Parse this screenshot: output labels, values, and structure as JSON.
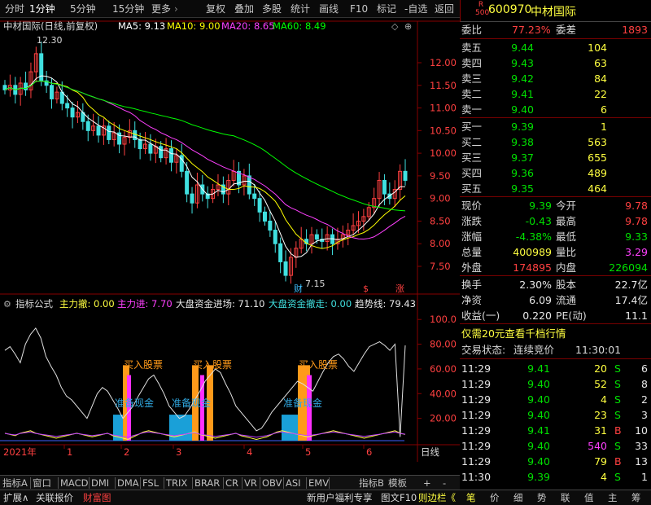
{
  "toolbar": {
    "periods": [
      "分时",
      "1分钟",
      "5分钟",
      "15分钟",
      "更多"
    ],
    "more_arrow": "›",
    "actions": [
      "复权",
      "叠加",
      "多股",
      "统计",
      "画线",
      "F10",
      "标记",
      "-自选",
      "返回"
    ]
  },
  "stock": {
    "code": "600970",
    "name": "中材国际",
    "badge_top": "R",
    "badge_bottom": "500"
  },
  "kline": {
    "title": "中材国际(日线,前复权)",
    "ma5_label": "MA5: 9.13",
    "ma10_label": "MA10: 9.00",
    "ma20_label": "MA20: 8.65",
    "ma60_label": "MA60: 8.49",
    "high_label": "12.30",
    "low_label": "7.15",
    "y_ticks": [
      "12.00",
      "11.50",
      "11.00",
      "10.50",
      "10.00",
      "9.50",
      "9.00",
      "8.50",
      "8.00",
      "7.50"
    ],
    "y_values": [
      12.0,
      11.5,
      11.0,
      10.5,
      10.0,
      9.5,
      9.0,
      8.5,
      8.0,
      7.5
    ],
    "ylim": [
      7.05,
      12.45
    ],
    "markers": [
      {
        "text": "财",
        "color": "#40c0ff"
      },
      {
        "text": "$",
        "color": "#ff4040"
      },
      {
        "text": "涨",
        "color": "#ff4040"
      }
    ],
    "colors": {
      "ma5": "#ffffff",
      "ma10": "#ffff00",
      "ma20": "#ff40ff",
      "ma60": "#00ff00",
      "up": "#ff4040",
      "down": "#40e0e0"
    }
  },
  "indicator": {
    "name": "指标公式",
    "labels": [
      {
        "text": "主力撤: 0.00",
        "color": "#ffff40"
      },
      {
        "text": "主力进: 7.70",
        "color": "#ff40ff"
      },
      {
        "text": "大盘资金进场: 71.10",
        "color": "#e8e8e8"
      },
      {
        "text": "大盘资金撤走: 0.00",
        "color": "#40e0e0"
      },
      {
        "text": "趋势线: 79.43",
        "color": "#e8e8e8"
      }
    ],
    "y_ticks": [
      "100.0",
      "80.00",
      "60.00",
      "40.00",
      "20.00"
    ],
    "y_values": [
      100,
      80,
      60,
      40,
      20
    ],
    "ylim": [
      0,
      112
    ],
    "buy_label": "买入股票",
    "prepare_label_1": "准备现金",
    "prepare_label_2": "准备现金",
    "prepare_label_3": "准备现金"
  },
  "x_axis": {
    "year_label": "2021年",
    "month_labels": [
      "1",
      "2",
      "3",
      "4",
      "5",
      "6"
    ],
    "period_label": "日线"
  },
  "quote": {
    "wei_bi_label": "委比",
    "wei_bi_value": "77.23%",
    "wei_cha_label": "委差",
    "wei_cha_value": "1893",
    "sells": [
      {
        "label": "卖五",
        "price": "9.44",
        "vol": "104"
      },
      {
        "label": "卖四",
        "price": "9.43",
        "vol": "63"
      },
      {
        "label": "卖三",
        "price": "9.42",
        "vol": "84"
      },
      {
        "label": "卖二",
        "price": "9.41",
        "vol": "22"
      },
      {
        "label": "卖一",
        "price": "9.40",
        "vol": "6"
      }
    ],
    "buys": [
      {
        "label": "买一",
        "price": "9.39",
        "vol": "1"
      },
      {
        "label": "买二",
        "price": "9.38",
        "vol": "563"
      },
      {
        "label": "买三",
        "price": "9.37",
        "vol": "655"
      },
      {
        "label": "买四",
        "price": "9.36",
        "vol": "489"
      },
      {
        "label": "买五",
        "price": "9.35",
        "vol": "464"
      }
    ],
    "stats": [
      {
        "l1": "现价",
        "v1": "9.39",
        "c1": "green",
        "l2": "今开",
        "v2": "9.78",
        "c2": "red"
      },
      {
        "l1": "涨跌",
        "v1": "-0.43",
        "c1": "green",
        "l2": "最高",
        "v2": "9.78",
        "c2": "red"
      },
      {
        "l1": "涨幅",
        "v1": "-4.38%",
        "c1": "green",
        "l2": "最低",
        "v2": "9.33",
        "c2": "green"
      },
      {
        "l1": "总量",
        "v1": "400989",
        "c1": "yellow",
        "l2": "量比",
        "v2": "3.29",
        "c2": "magenta"
      },
      {
        "l1": "外盘",
        "v1": "174895",
        "c1": "red",
        "l2": "内盘",
        "v2": "226094",
        "c2": "green"
      }
    ],
    "fin": [
      {
        "l1": "换手",
        "v1": "2.30%",
        "l2": "股本",
        "v2": "22.7亿"
      },
      {
        "l1": "净资",
        "v1": "6.09",
        "l2": "流通",
        "v2": "17.4亿"
      },
      {
        "l1": "收益(一)",
        "v1": "0.220",
        "l2": "PE(动)",
        "v2": "11.1"
      }
    ],
    "promo": "仅需20元查看千档行情",
    "trade_status_label": "交易状态:",
    "trade_status_value": "连续竞价",
    "trade_time": "11:30:01",
    "ticks": [
      {
        "time": "11:29",
        "price": "9.41",
        "vol": "20",
        "bs": "S",
        "n": "6",
        "vc": "yellow",
        "bsc": "green"
      },
      {
        "time": "11:29",
        "price": "9.40",
        "vol": "52",
        "bs": "S",
        "n": "8",
        "vc": "yellow",
        "bsc": "green"
      },
      {
        "time": "11:29",
        "price": "9.40",
        "vol": "4",
        "bs": "S",
        "n": "2",
        "vc": "yellow",
        "bsc": "green"
      },
      {
        "time": "11:29",
        "price": "9.40",
        "vol": "23",
        "bs": "S",
        "n": "3",
        "vc": "yellow",
        "bsc": "green"
      },
      {
        "time": "11:29",
        "price": "9.41",
        "vol": "31",
        "bs": "B",
        "n": "10",
        "vc": "yellow",
        "bsc": "red"
      },
      {
        "time": "11:29",
        "price": "9.40",
        "vol": "540",
        "bs": "S",
        "n": "33",
        "vc": "magenta",
        "bsc": "green"
      },
      {
        "time": "11:29",
        "price": "9.40",
        "vol": "79",
        "bs": "B",
        "n": "13",
        "vc": "yellow",
        "bsc": "red"
      },
      {
        "time": "11:30",
        "price": "9.39",
        "vol": "4",
        "bs": "S",
        "n": "1",
        "vc": "yellow",
        "bsc": "green"
      }
    ]
  },
  "bottom_tabs": [
    "指标A",
    "窗口",
    "MACD",
    "DMI",
    "DMA",
    "FSL",
    "TRIX",
    "BRAR",
    "CR",
    "VR",
    "OBV",
    "ASI",
    "EMV"
  ],
  "bottom_tabs_right": [
    "指标B",
    "模板",
    "+",
    "-"
  ],
  "status_tabs": [
    "扩展∧",
    "关联报价",
    "财富图"
  ],
  "status_right": [
    "新用户福利专享",
    "图文F10",
    "则边栏《"
  ],
  "right_tabs": [
    "笔",
    "价",
    "细",
    "势",
    "联",
    "值",
    "主",
    "筹"
  ]
}
